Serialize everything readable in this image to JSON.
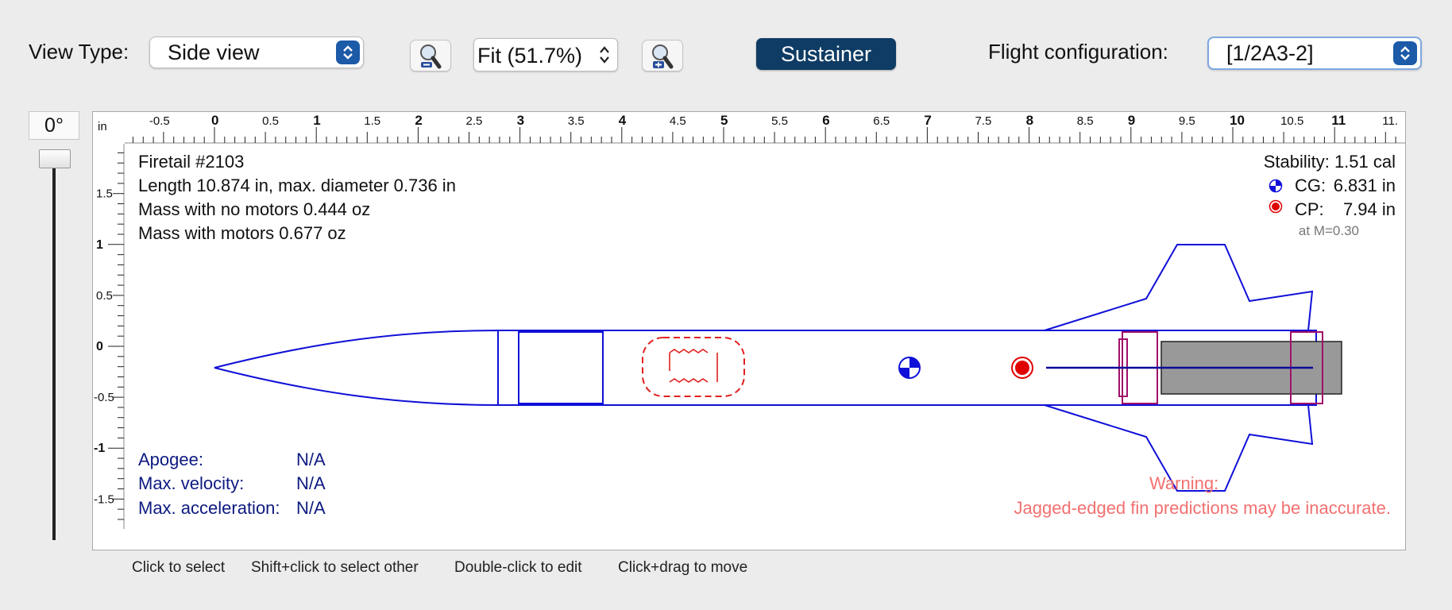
{
  "toolbar": {
    "view_type_label": "View Type:",
    "view_type_value": "Side view",
    "zoom_value": "Fit (51.7%)",
    "zoom_out_icon": "zoom-out-icon",
    "zoom_in_icon": "zoom-in-icon",
    "stage_button": "Sustainer",
    "flight_config_label": "Flight configuration:",
    "flight_config_value": "[1/2A3-2]"
  },
  "rotation": {
    "label": "0°"
  },
  "ruler": {
    "unit": "in",
    "x_ticks": [
      "-0.5",
      "0",
      "0.5",
      "1",
      "1.5",
      "2",
      "2.5",
      "3",
      "3.5",
      "4",
      "4.5",
      "5",
      "5.5",
      "6",
      "6.5",
      "7",
      "7.5",
      "8",
      "8.5",
      "9",
      "9.5",
      "10",
      "10.5",
      "11",
      "11."
    ],
    "y_ticks": [
      "1.5",
      "1",
      "0.5",
      "0",
      "-0.5",
      "-1",
      "-1.5"
    ]
  },
  "info": {
    "name": "Firetail #2103",
    "length_line": "Length 10.874 in, max. diameter 0.736 in",
    "mass_no_motors": "Mass with no motors 0.444 oz",
    "mass_with_motors": "Mass with motors 0.677 oz"
  },
  "stability": {
    "stability_line": "Stability: 1.51 cal",
    "cg_label": "CG:",
    "cg_value": "6.831 in",
    "cp_label": "CP:",
    "cp_value": "7.94 in",
    "mach": "at M=0.30"
  },
  "flight": {
    "apogee_label": "Apogee:",
    "apogee_value": "N/A",
    "velocity_label": "Max. velocity:",
    "velocity_value": "N/A",
    "accel_label": "Max. acceleration:",
    "accel_value": "N/A"
  },
  "warning": {
    "title": "Warning:",
    "message": "Jagged-edged fin predictions may be inaccurate."
  },
  "hints": {
    "h1": "Click to select",
    "h2": "Shift+click to select other",
    "h3": "Double-click to edit",
    "h4": "Click+drag to move"
  },
  "colors": {
    "outline": "#1010d8",
    "cp_red": "#e00000",
    "motor_gray": "#999999",
    "mount_magenta": "#a0106a",
    "warning": "#f37070",
    "flight_text": "#0d1a80",
    "button_bg": "#0f3c64"
  }
}
